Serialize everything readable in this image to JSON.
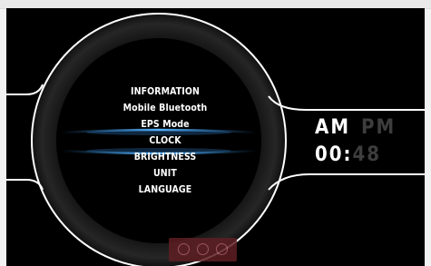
{
  "menu": {
    "items": [
      {
        "label": "INFORMATION"
      },
      {
        "label": "Mobile Bluetooth"
      },
      {
        "label": "EPS Mode"
      },
      {
        "label": "CLOCK",
        "selected": true
      },
      {
        "label": "BRIGHTNESS"
      },
      {
        "label": "UNIT"
      },
      {
        "label": "LANGUAGE"
      }
    ]
  },
  "clock": {
    "am_label": "AM",
    "pm_label": "PM",
    "active_period": "AM",
    "hour": "00",
    "separator": ":",
    "minute": "48"
  },
  "colors": {
    "background": "#000000",
    "ring": "#1a1a1a",
    "highlight": "#2f8fd8",
    "inactive_text": "#3d3d3d",
    "control_bar": "#5e1f23"
  },
  "controls": {
    "icons": [
      "back-icon",
      "select-icon",
      "search-icon"
    ]
  }
}
